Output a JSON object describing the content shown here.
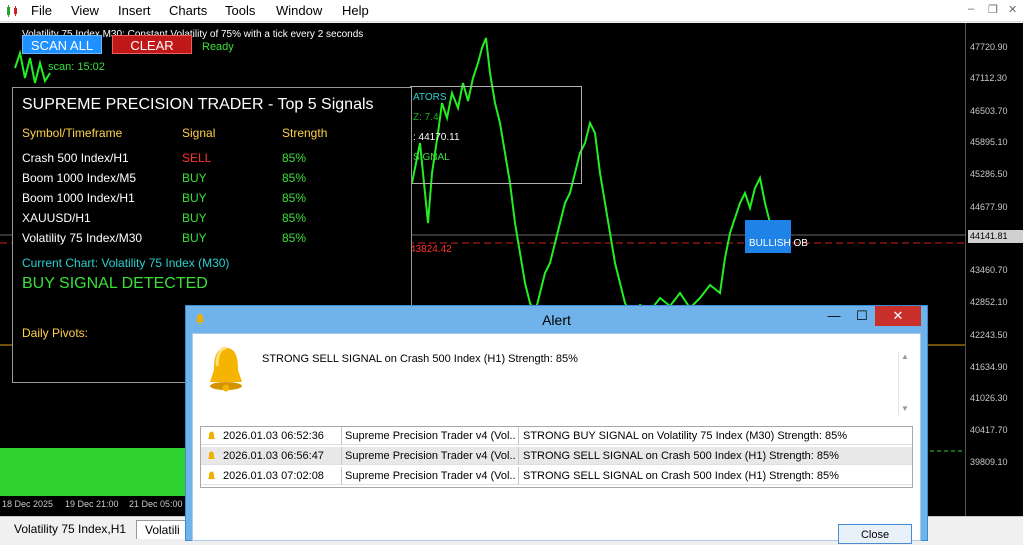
{
  "menubar": {
    "items": [
      "File",
      "View",
      "Insert",
      "Charts",
      "Tools",
      "Window",
      "Help"
    ],
    "controls": {
      "minimize": "–",
      "restore": "❐",
      "close": "✕"
    }
  },
  "chart": {
    "title": "Volatility 75 Index,M30:  Constant Volatility of 75% with a tick every 2 seconds",
    "scan_button": "SCAN ALL",
    "clear_button": "CLEAR",
    "status": "Ready",
    "last_scan": "scan: 15:02",
    "price_ticks": [
      "47720.90",
      "47112.30",
      "46503.70",
      "45895.10",
      "45286.50",
      "44677.90",
      "43460.70",
      "42852.10",
      "42243.50",
      "41634.90",
      "41026.30",
      "40417.70",
      "39809.10"
    ],
    "current_price": "44141.81",
    "time_ticks": [
      "18 Dec 2025",
      "19 Dec 21:00",
      "21 Dec 05:00"
    ],
    "bullish_ob": "BULLISH OB",
    "red_price_label": "43824.42",
    "indicator_lines": [
      "ATORS",
      "Z: 7.4",
      ": 44170.11",
      "SIGNAL"
    ]
  },
  "panel": {
    "title": "SUPREME PRECISION TRADER - Top 5 Signals",
    "headers": {
      "symbol": "Symbol/Timeframe",
      "signal": "Signal",
      "strength": "Strength"
    },
    "rows": [
      {
        "symbol": "Crash 500 Index/H1",
        "signal": "SELL",
        "strength": "85%"
      },
      {
        "symbol": "Boom 1000 Index/M5",
        "signal": "BUY",
        "strength": "85%"
      },
      {
        "symbol": "Boom 1000 Index/H1",
        "signal": "BUY",
        "strength": "85%"
      },
      {
        "symbol": "XAUUSD/H1",
        "signal": "BUY",
        "strength": "85%"
      },
      {
        "symbol": "Volatility 75 Index/M30",
        "signal": "BUY",
        "strength": "85%"
      }
    ],
    "current_chart": "Current Chart: Volatility 75 Index (M30)",
    "detected": "BUY SIGNAL DETECTED",
    "pivots": "Daily Pivots:"
  },
  "tabs": [
    "Volatility 75 Index,H1",
    "Volatili"
  ],
  "alert": {
    "title": "Alert",
    "message": "STRONG SELL SIGNAL on Crash 500 Index (H1) Strength: 85%",
    "rows": [
      {
        "time": "2026.01.03 06:52:36",
        "source": "Supreme Precision Trader v4 (Vol...",
        "text": "STRONG BUY SIGNAL on Volatility 75 Index (M30) Strength: 85%"
      },
      {
        "time": "2026.01.03 06:56:47",
        "source": "Supreme Precision Trader v4 (Vol...",
        "text": "STRONG SELL SIGNAL on Crash 500 Index (H1) Strength: 85%"
      },
      {
        "time": "2026.01.03 07:02:08",
        "source": "Supreme Precision Trader v4 (Vol...",
        "text": "STRONG SELL SIGNAL on Crash 500 Index (H1) Strength: 85%"
      }
    ],
    "close_button": "Close",
    "min": "—",
    "max": "☐",
    "close_x": "✕"
  },
  "colors": {
    "buy": "#39e039",
    "sell": "#ff3030",
    "accent_blue": "#1e90ff",
    "panel_yellow": "#ffd24a"
  }
}
